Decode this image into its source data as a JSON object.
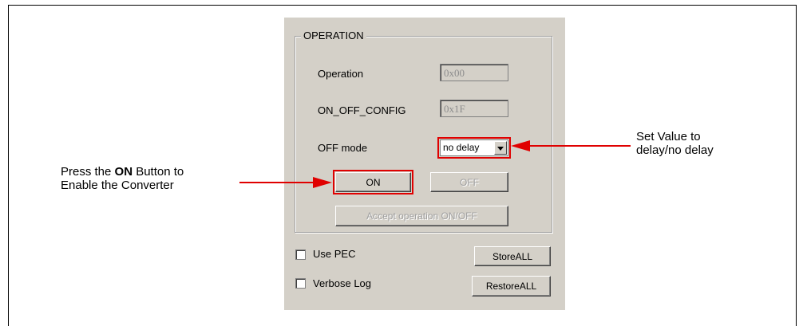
{
  "group": {
    "title": "OPERATION"
  },
  "fields": {
    "operation_label": "Operation",
    "operation_value": "0x00",
    "onoff_config_label": "ON_OFF_CONFIG",
    "onoff_config_value": "0x1F",
    "off_mode_label": "OFF mode",
    "off_mode_value": "no delay"
  },
  "buttons": {
    "on": "ON",
    "off": "OFF",
    "accept": "Accept operation ON/OFF",
    "store_all": "StoreALL",
    "restore_all": "RestoreALL"
  },
  "checkboxes": {
    "use_pec": "Use PEC",
    "verbose_log": "Verbose Log"
  },
  "callouts": {
    "left_pre": "Press the ",
    "left_bold": "ON",
    "left_post": " Button to",
    "left_line2": "Enable the Converter",
    "right_line1": "Set Value to",
    "right_line2": "delay/no delay"
  },
  "colors": {
    "highlight": "#e00000",
    "panel_bg": "#d4d0c8"
  },
  "icons": {
    "dropdown": "chevron-down-icon"
  }
}
